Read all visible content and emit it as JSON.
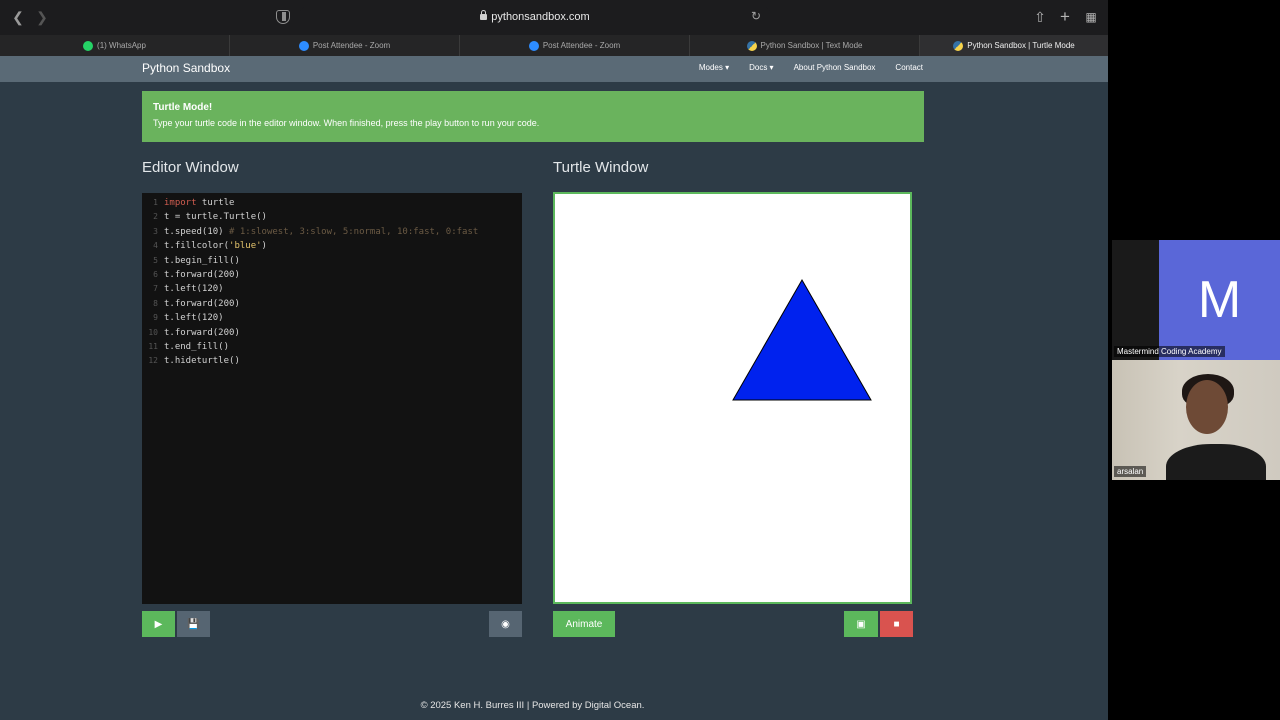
{
  "browser": {
    "url": "pythonsandbox.com",
    "tabs": [
      {
        "label": "(1) WhatsApp",
        "icon": "whatsapp-icon"
      },
      {
        "label": "Post Attendee - Zoom",
        "icon": "zoom-icon"
      },
      {
        "label": "Post Attendee - Zoom",
        "icon": "zoom-icon"
      },
      {
        "label": "Python Sandbox | Text Mode",
        "icon": "python-icon"
      },
      {
        "label": "Python Sandbox | Turtle Mode",
        "icon": "python-icon"
      }
    ]
  },
  "navbar": {
    "brand": "Python Sandbox",
    "links": [
      "Modes ▾",
      "Docs ▾",
      "About Python Sandbox",
      "Contact"
    ]
  },
  "alert": {
    "title": "Turtle Mode!",
    "text": "Type your turtle code in the editor window. When finished, press the play button to run your code."
  },
  "editor": {
    "title": "Editor Window",
    "lines": [
      "import turtle",
      "t = turtle.Turtle()",
      "t.speed(10) # 1:slowest, 3:slow, 5:normal, 10:fast, 0:fast",
      "t.fillcolor('blue')",
      "t.begin_fill()",
      "t.forward(200)",
      "t.left(120)",
      "t.forward(200)",
      "t.left(120)",
      "t.forward(200)",
      "t.end_fill()",
      "t.hideturtle()"
    ]
  },
  "turtle": {
    "title": "Turtle Window",
    "shape_fill": "#0022ee",
    "animate_label": "Animate"
  },
  "footer": {
    "text": "© 2025 Ken H. Burres III | Powered by Digital Ocean."
  },
  "zoom": {
    "participants": [
      {
        "name": "Mastermind Coding Academy",
        "initial": "M"
      },
      {
        "name": "arsalan"
      }
    ]
  },
  "colors": {
    "accent_green": "#5cb85c",
    "danger_red": "#d9534f",
    "page_bg": "#2d3b46"
  }
}
